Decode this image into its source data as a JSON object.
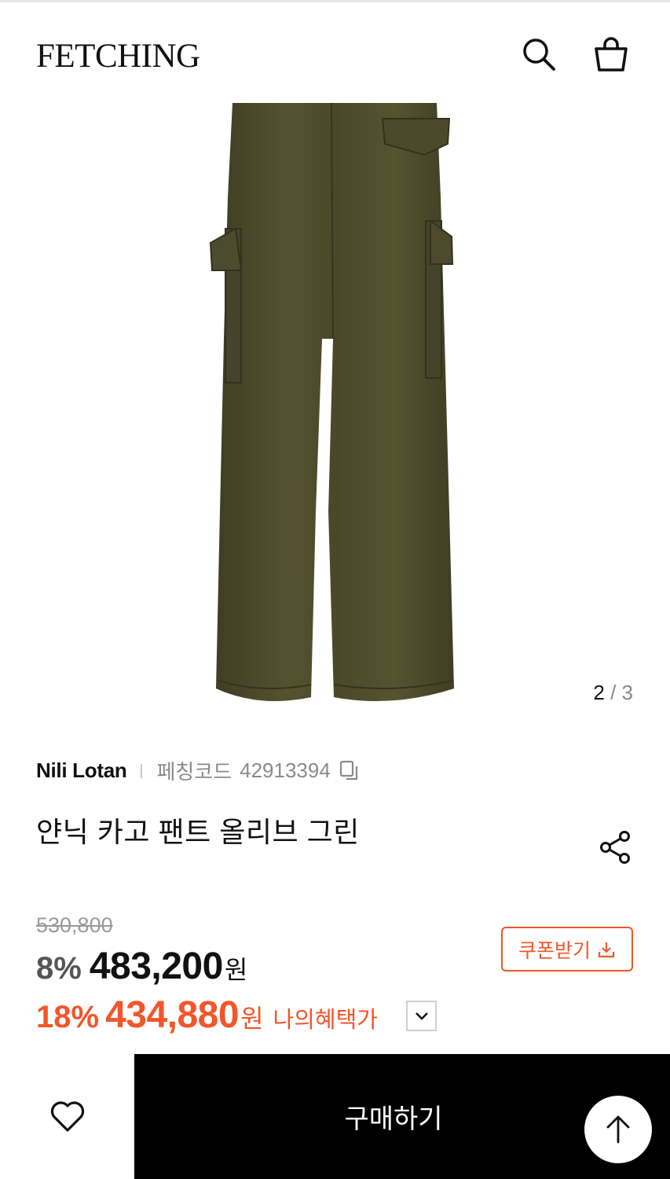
{
  "header": {
    "logo": "FETCHING",
    "search_icon": "search-icon",
    "bag_icon": "shopping-bag-icon"
  },
  "gallery": {
    "current": "2",
    "separator": "/",
    "total": "3",
    "image_subject": "olive cargo pants back view",
    "product_color": "#4d4b2e"
  },
  "product": {
    "brand": "Nili Lotan",
    "code_label": "페칭코드",
    "code": "42913394",
    "title": "얀닉 카고 팬트 올리브 그린"
  },
  "pricing": {
    "original_price": "530,800",
    "discount1": "8%",
    "price1": "483,200",
    "currency": "원",
    "discount2": "18%",
    "price2": "434,880",
    "benefit_label": "나의혜택가",
    "coupon_label": "쿠폰받기",
    "accent_color": "#f2562a"
  },
  "bottom": {
    "wishlist_icon": "heart-icon",
    "buy_label": "구매하기",
    "scroll_top_icon": "arrow-up-icon"
  }
}
